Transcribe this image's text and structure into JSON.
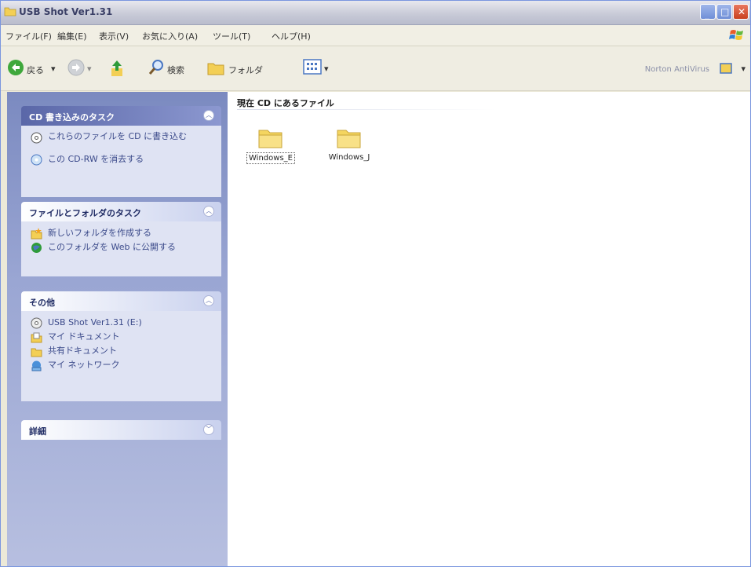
{
  "window": {
    "title": "USB Shot Ver1.31",
    "icon": "folder-icon"
  },
  "menubar": {
    "items": [
      "ファイル(F)",
      "編集(E)",
      "表示(V)",
      "お気に入り(A)",
      "ツール(T)",
      "ヘルプ(H)"
    ]
  },
  "toolbar": {
    "back_label": "戻る",
    "search_label": "検索",
    "folders_label": "フォルダ",
    "norton_label": "Norton AntiVirus"
  },
  "sidebar": {
    "panels": [
      {
        "title": "CD 書き込みのタスク",
        "tasks": [
          "これらのファイルを CD に書き込む",
          "この CD-RW を消去する"
        ]
      },
      {
        "title": "ファイルとフォルダのタスク",
        "tasks": [
          "新しいフォルダを作成する",
          "このフォルダを Web に公開する"
        ]
      },
      {
        "title": "その他",
        "tasks": [
          "USB Shot Ver1.31 (E:)",
          "マイ ドキュメント",
          "共有ドキュメント",
          "マイ ネットワーク"
        ]
      },
      {
        "title": "詳細",
        "tasks": []
      }
    ]
  },
  "main": {
    "section_title": "現在 CD にあるファイル",
    "files": [
      {
        "name": "Windows_E",
        "selected": true
      },
      {
        "name": "Windows_J",
        "selected": false
      }
    ]
  },
  "colors": {
    "sidebar_top": "#7b8ac0",
    "sidebar_bottom": "#b7bfe0",
    "panel_body": "#dfe3f3",
    "folder_yellow": "#f4d560"
  }
}
